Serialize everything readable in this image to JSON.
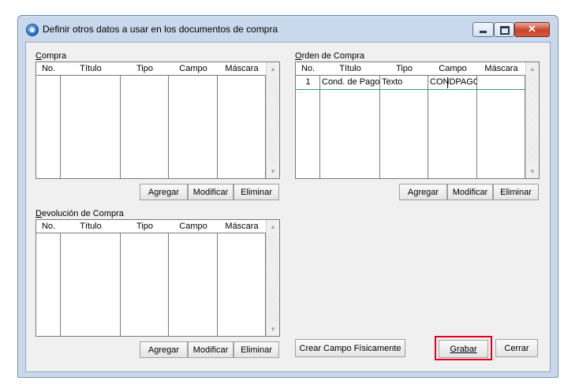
{
  "window": {
    "title": "Definir otros datos a usar en los documentos de compra"
  },
  "columns": [
    "No.",
    "Título",
    "Tipo",
    "Campo",
    "Máscara"
  ],
  "compra": {
    "label": "Compra",
    "buttons": {
      "add": "Agregar",
      "modify": "Modificar",
      "delete": "Eliminar"
    }
  },
  "orden": {
    "label": "Orden de Compra",
    "rows": [
      {
        "no": "1",
        "titulo": "Cond. de Pago",
        "tipo": "Texto",
        "campo": "CONDPAGO",
        "mascara": ""
      }
    ],
    "buttons": {
      "add": "Agregar",
      "modify": "Modificar",
      "delete": "Eliminar"
    }
  },
  "devolucion": {
    "label": "Devolución de Compra",
    "buttons": {
      "add": "Agregar",
      "modify": "Modificar",
      "delete": "Eliminar"
    }
  },
  "footer": {
    "crear_campo": "Crear Campo Físicamente",
    "grabar": "Grabar",
    "cerrar": "Cerrar"
  },
  "colors": {
    "highlight_border": "#e0001b",
    "row_line": "#2a9a9a"
  }
}
